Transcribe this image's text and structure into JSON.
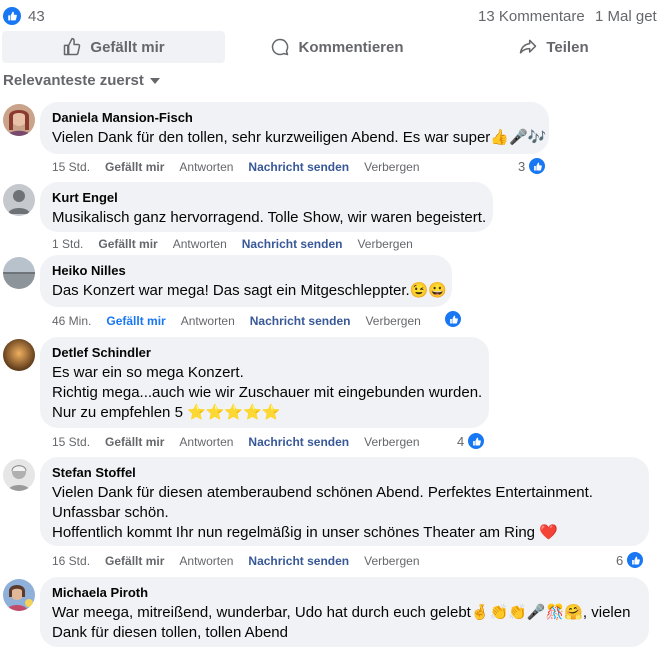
{
  "summary": {
    "like_count": "43",
    "comments": "13 Kommentare",
    "shares": "1 Mal get"
  },
  "actions": {
    "like": "Gefällt mir",
    "comment": "Kommentieren",
    "share": "Teilen"
  },
  "sort_label": "Relevanteste zuerst",
  "links": {
    "like": "Gefällt mir",
    "reply": "Antworten",
    "message": "Nachricht senden",
    "hide": "Verbergen"
  },
  "comments": [
    {
      "author": "Daniela Mansion-Fisch",
      "lines": [
        "Vielen Dank für den tollen, sehr kurzweiligen Abend. Es war super👍🎤🎶"
      ],
      "time": "15 Std.",
      "reactions": "3"
    },
    {
      "author": "Kurt Engel",
      "lines": [
        "Musikalisch ganz hervorragend. Tolle Show, wir waren begeistert."
      ],
      "time": "1 Std.",
      "reactions": ""
    },
    {
      "author": "Heiko Nilles",
      "lines": [
        "Das Konzert war mega! Das sagt ein Mitgeschleppter.😉😀"
      ],
      "time": "46 Min.",
      "reactions": ""
    },
    {
      "author": "Detlef Schindler",
      "lines": [
        "Es war ein so mega Konzert.",
        "Richtig mega...auch wie wir Zuschauer mit eingebunden wurden.",
        "Nur zu empfehlen 5 ⭐⭐⭐⭐⭐"
      ],
      "time": "15 Std.",
      "reactions": "4"
    },
    {
      "author": "Stefan Stoffel",
      "lines": [
        "Vielen Dank für diesen atemberaubend schönen Abend. Perfektes Entertainment.",
        "Unfassbar schön.",
        "Hoffentlich kommt Ihr nun regelmäßig in unser schönes Theater am Ring ❤️"
      ],
      "time": "16 Std.",
      "reactions": "6"
    },
    {
      "author": "Michaela Piroth",
      "lines": [
        "War meega, mitreißend, wunderbar, Udo hat durch euch gelebt🤞👏👏🎤🎊🤗, vielen",
        "Dank für diesen tollen, tollen Abend"
      ],
      "time": "",
      "reactions": ""
    }
  ],
  "colors": {
    "accent": "#1877f2",
    "bubble": "#f0f2f5",
    "muted": "#65676b",
    "link": "#385898"
  }
}
